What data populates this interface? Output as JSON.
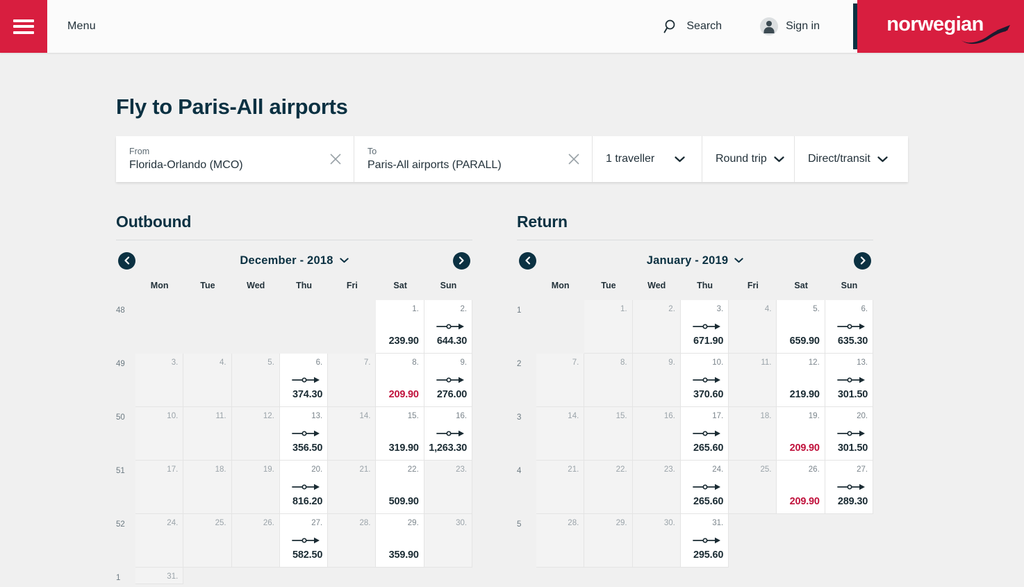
{
  "header": {
    "menu_label": "Menu",
    "search_label": "Search",
    "signin_label": "Sign in",
    "logo_text": "norwegian",
    "brand_red": "#d81e3f",
    "brand_navy": "#0b3142"
  },
  "page": {
    "title": "Fly to Paris-All airports",
    "background": "#f0f0f0"
  },
  "search_form": {
    "from": {
      "label": "From",
      "value": "Florida-Orlando (MCO)"
    },
    "to": {
      "label": "To",
      "value": "Paris-All airports (PARALL)"
    },
    "travellers": "1 traveller",
    "trip_type": "Round trip",
    "route_type": "Direct/transit"
  },
  "calendars": [
    {
      "id": "outbound",
      "heading": "Outbound",
      "month_label": "December - 2018",
      "prev_focused": false,
      "next_focused": true,
      "dow": [
        "Mon",
        "Tue",
        "Wed",
        "Thu",
        "Fri",
        "Sat",
        "Sun"
      ],
      "weeks": [
        {
          "week": "48",
          "days": [
            {
              "day": "",
              "price": "",
              "flight": false,
              "state": "empty"
            },
            {
              "day": "",
              "price": "",
              "flight": false,
              "state": "empty"
            },
            {
              "day": "",
              "price": "",
              "flight": false,
              "state": "empty"
            },
            {
              "day": "",
              "price": "",
              "flight": false,
              "state": "empty"
            },
            {
              "day": "",
              "price": "",
              "flight": false,
              "state": "empty"
            },
            {
              "day": "1.",
              "price": "239.90",
              "flight": false,
              "state": "avail"
            },
            {
              "day": "2.",
              "price": "644.30",
              "flight": true,
              "state": "avail"
            }
          ]
        },
        {
          "week": "49",
          "days": [
            {
              "day": "3.",
              "price": "",
              "flight": false,
              "state": "dim"
            },
            {
              "day": "4.",
              "price": "",
              "flight": false,
              "state": "dim"
            },
            {
              "day": "5.",
              "price": "",
              "flight": false,
              "state": "dim"
            },
            {
              "day": "6.",
              "price": "374.30",
              "flight": true,
              "state": "avail"
            },
            {
              "day": "7.",
              "price": "",
              "flight": false,
              "state": "dim"
            },
            {
              "day": "8.",
              "price": "209.90",
              "flight": false,
              "state": "avail",
              "cheap": true
            },
            {
              "day": "9.",
              "price": "276.00",
              "flight": true,
              "state": "avail"
            }
          ]
        },
        {
          "week": "50",
          "days": [
            {
              "day": "10.",
              "price": "",
              "flight": false,
              "state": "dim"
            },
            {
              "day": "11.",
              "price": "",
              "flight": false,
              "state": "dim"
            },
            {
              "day": "12.",
              "price": "",
              "flight": false,
              "state": "dim"
            },
            {
              "day": "13.",
              "price": "356.50",
              "flight": true,
              "state": "avail"
            },
            {
              "day": "14.",
              "price": "",
              "flight": false,
              "state": "dim"
            },
            {
              "day": "15.",
              "price": "319.90",
              "flight": false,
              "state": "avail"
            },
            {
              "day": "16.",
              "price": "1,263.30",
              "flight": true,
              "state": "avail"
            }
          ]
        },
        {
          "week": "51",
          "days": [
            {
              "day": "17.",
              "price": "",
              "flight": false,
              "state": "dim"
            },
            {
              "day": "18.",
              "price": "",
              "flight": false,
              "state": "dim"
            },
            {
              "day": "19.",
              "price": "",
              "flight": false,
              "state": "dim"
            },
            {
              "day": "20.",
              "price": "816.20",
              "flight": true,
              "state": "avail"
            },
            {
              "day": "21.",
              "price": "",
              "flight": false,
              "state": "dim"
            },
            {
              "day": "22.",
              "price": "509.90",
              "flight": false,
              "state": "avail"
            },
            {
              "day": "23.",
              "price": "",
              "flight": false,
              "state": "dim"
            }
          ]
        },
        {
          "week": "52",
          "days": [
            {
              "day": "24.",
              "price": "",
              "flight": false,
              "state": "dim"
            },
            {
              "day": "25.",
              "price": "",
              "flight": false,
              "state": "dim"
            },
            {
              "day": "26.",
              "price": "",
              "flight": false,
              "state": "dim"
            },
            {
              "day": "27.",
              "price": "582.50",
              "flight": true,
              "state": "avail"
            },
            {
              "day": "28.",
              "price": "",
              "flight": false,
              "state": "dim"
            },
            {
              "day": "29.",
              "price": "359.90",
              "flight": false,
              "state": "avail"
            },
            {
              "day": "30.",
              "price": "",
              "flight": false,
              "state": "dim"
            }
          ]
        },
        {
          "week": "1",
          "partial": true,
          "days": [
            {
              "day": "31.",
              "price": "",
              "flight": false,
              "state": "dim"
            },
            {
              "day": "",
              "price": "",
              "flight": false,
              "state": "empty"
            },
            {
              "day": "",
              "price": "",
              "flight": false,
              "state": "empty"
            },
            {
              "day": "",
              "price": "",
              "flight": false,
              "state": "empty"
            },
            {
              "day": "",
              "price": "",
              "flight": false,
              "state": "empty"
            },
            {
              "day": "",
              "price": "",
              "flight": false,
              "state": "empty"
            },
            {
              "day": "",
              "price": "",
              "flight": false,
              "state": "empty"
            }
          ]
        }
      ]
    },
    {
      "id": "return",
      "heading": "Return",
      "month_label": "January - 2019",
      "prev_focused": false,
      "next_focused": false,
      "dow": [
        "Mon",
        "Tue",
        "Wed",
        "Thu",
        "Fri",
        "Sat",
        "Sun"
      ],
      "weeks": [
        {
          "week": "1",
          "days": [
            {
              "day": "",
              "price": "",
              "flight": false,
              "state": "empty"
            },
            {
              "day": "1.",
              "price": "",
              "flight": false,
              "state": "dim"
            },
            {
              "day": "2.",
              "price": "",
              "flight": false,
              "state": "dim"
            },
            {
              "day": "3.",
              "price": "671.90",
              "flight": true,
              "state": "avail"
            },
            {
              "day": "4.",
              "price": "",
              "flight": false,
              "state": "dim"
            },
            {
              "day": "5.",
              "price": "659.90",
              "flight": false,
              "state": "avail"
            },
            {
              "day": "6.",
              "price": "635.30",
              "flight": true,
              "state": "avail"
            }
          ]
        },
        {
          "week": "2",
          "days": [
            {
              "day": "7.",
              "price": "",
              "flight": false,
              "state": "dim"
            },
            {
              "day": "8.",
              "price": "",
              "flight": false,
              "state": "dim"
            },
            {
              "day": "9.",
              "price": "",
              "flight": false,
              "state": "dim"
            },
            {
              "day": "10.",
              "price": "370.60",
              "flight": true,
              "state": "avail"
            },
            {
              "day": "11.",
              "price": "",
              "flight": false,
              "state": "dim"
            },
            {
              "day": "12.",
              "price": "219.90",
              "flight": false,
              "state": "avail"
            },
            {
              "day": "13.",
              "price": "301.50",
              "flight": true,
              "state": "avail"
            }
          ]
        },
        {
          "week": "3",
          "days": [
            {
              "day": "14.",
              "price": "",
              "flight": false,
              "state": "dim"
            },
            {
              "day": "15.",
              "price": "",
              "flight": false,
              "state": "dim"
            },
            {
              "day": "16.",
              "price": "",
              "flight": false,
              "state": "dim"
            },
            {
              "day": "17.",
              "price": "265.60",
              "flight": true,
              "state": "avail"
            },
            {
              "day": "18.",
              "price": "",
              "flight": false,
              "state": "dim"
            },
            {
              "day": "19.",
              "price": "209.90",
              "flight": false,
              "state": "avail",
              "cheap": true
            },
            {
              "day": "20.",
              "price": "301.50",
              "flight": true,
              "state": "avail"
            }
          ]
        },
        {
          "week": "4",
          "days": [
            {
              "day": "21.",
              "price": "",
              "flight": false,
              "state": "dim"
            },
            {
              "day": "22.",
              "price": "",
              "flight": false,
              "state": "dim"
            },
            {
              "day": "23.",
              "price": "",
              "flight": false,
              "state": "dim"
            },
            {
              "day": "24.",
              "price": "265.60",
              "flight": true,
              "state": "avail"
            },
            {
              "day": "25.",
              "price": "",
              "flight": false,
              "state": "dim"
            },
            {
              "day": "26.",
              "price": "209.90",
              "flight": false,
              "state": "avail",
              "cheap": true
            },
            {
              "day": "27.",
              "price": "289.30",
              "flight": true,
              "state": "avail"
            }
          ]
        },
        {
          "week": "5",
          "days": [
            {
              "day": "28.",
              "price": "",
              "flight": false,
              "state": "dim"
            },
            {
              "day": "29.",
              "price": "",
              "flight": false,
              "state": "dim"
            },
            {
              "day": "30.",
              "price": "",
              "flight": false,
              "state": "dim"
            },
            {
              "day": "31.",
              "price": "295.60",
              "flight": true,
              "state": "avail"
            },
            {
              "day": "",
              "price": "",
              "flight": false,
              "state": "empty"
            },
            {
              "day": "",
              "price": "",
              "flight": false,
              "state": "empty"
            },
            {
              "day": "",
              "price": "",
              "flight": false,
              "state": "empty"
            }
          ]
        }
      ]
    }
  ],
  "colors": {
    "price_normal": "#1a2b33",
    "price_cheap": "#c0123c",
    "cell_available": "#ffffff",
    "cell_unavailable": "#f3f3f3"
  }
}
